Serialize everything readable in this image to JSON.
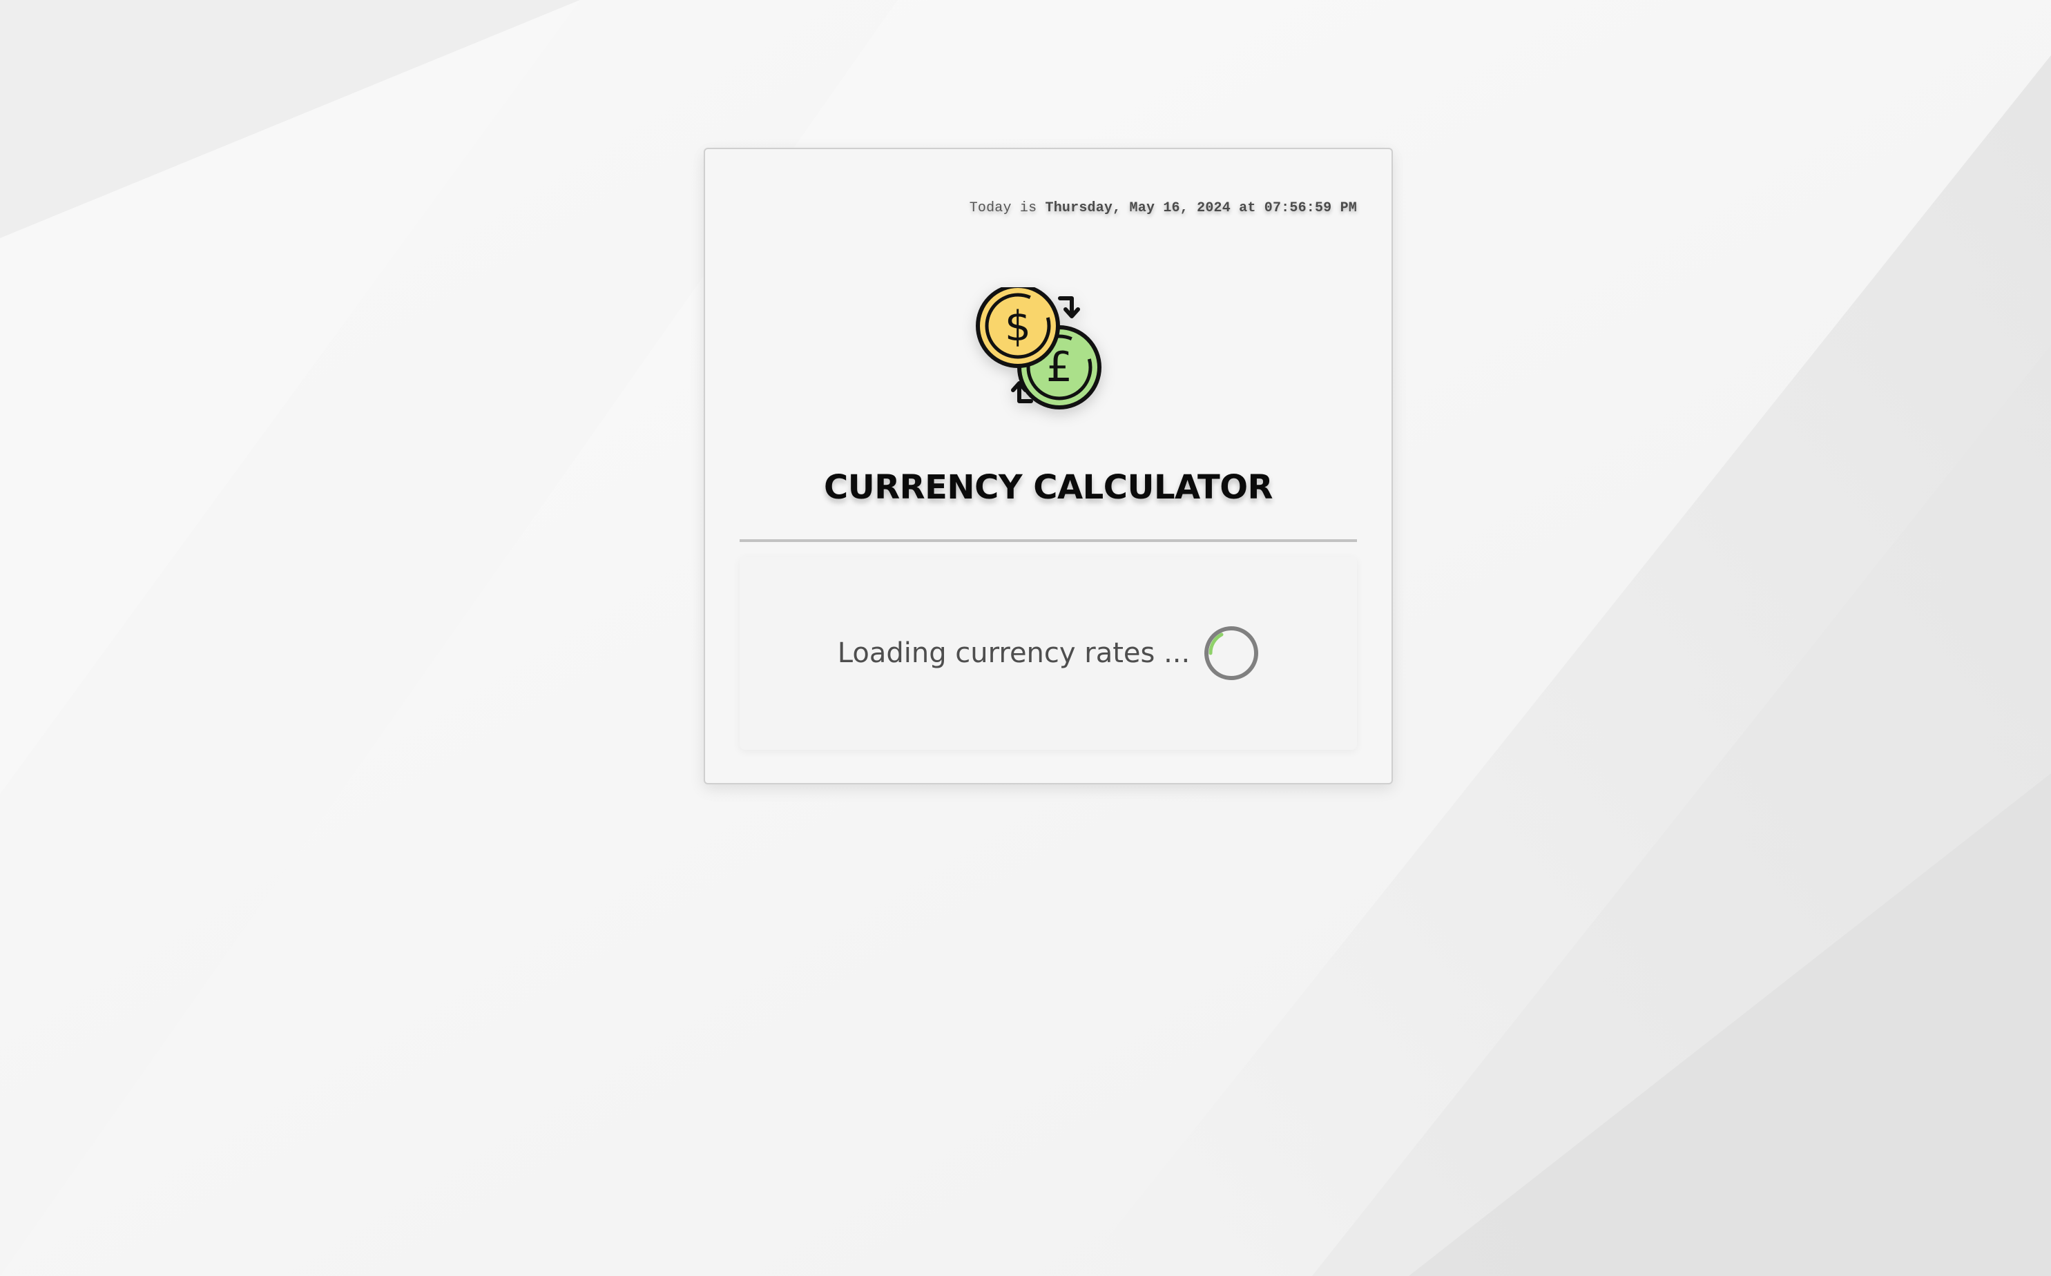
{
  "header": {
    "date_prefix": "Today is",
    "date_value": "Thursday, May 16, 2024 at 07:56:59 PM"
  },
  "logo": {
    "icon": "currency-exchange-icon",
    "coin_primary_symbol": "$",
    "coin_secondary_symbol": "£",
    "coin_primary_color": "#f9d56b",
    "coin_secondary_color": "#abe08a"
  },
  "title": "CURRENCY CALCULATOR",
  "loading": {
    "text": "Loading currency rates ...",
    "spinner_icon": "loading-spinner-icon",
    "spinner_accent_color": "#8fd16a"
  },
  "colors": {
    "background": "#f1f1f1",
    "card": "#f6f6f6",
    "title": "#0b0b0b"
  }
}
